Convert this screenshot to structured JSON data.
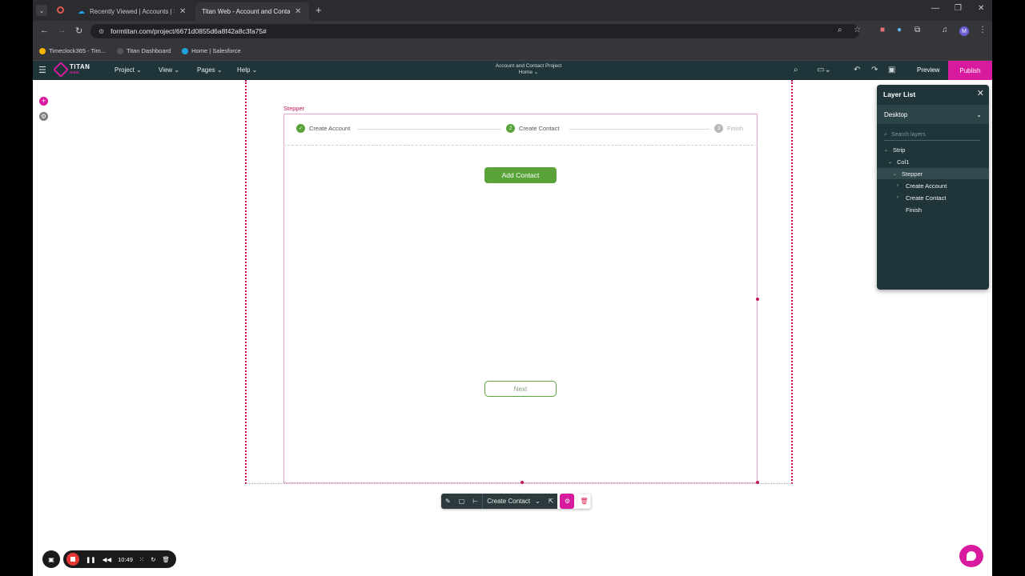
{
  "browser": {
    "tabs": [
      {
        "title": "Recently Viewed | Accounts | Sa",
        "active": false
      },
      {
        "title": "Titan Web - Account and Conta",
        "active": true
      }
    ],
    "url": "formtitan.com/project/6671d0855d6a8f42a8c3fa75#",
    "bookmarks": [
      "Timeclock365 - Tim...",
      "Titan Dashboard",
      "Home | Salesforce"
    ],
    "profile_initial": "M"
  },
  "header": {
    "logo": "TITAN",
    "logo_sub": "WEB",
    "menu": [
      "Project",
      "View",
      "Pages",
      "Help"
    ],
    "project_name": "Account and Contact Project",
    "page_name": "Home",
    "preview": "Preview",
    "publish": "Publish"
  },
  "canvas": {
    "stepper_label": "Stepper",
    "steps": [
      {
        "number": "✓",
        "label": "Create Account",
        "state": "done"
      },
      {
        "number": "2",
        "label": "Create Contact",
        "state": "active"
      },
      {
        "number": "3",
        "label": "Finish",
        "state": "pending"
      }
    ],
    "add_contact_label": "Add Contact",
    "next_label": "Next"
  },
  "toolbar": {
    "component_select": "Create Contact"
  },
  "layer_list": {
    "title": "Layer List",
    "device": "Desktop",
    "search_placeholder": "Search layers",
    "items": [
      {
        "label": "Strip",
        "caret": "⌄"
      },
      {
        "label": "Col1",
        "caret": "⌄"
      },
      {
        "label": "Stepper",
        "caret": "⌄",
        "selected": true
      },
      {
        "label": "Create Account",
        "caret": "›"
      },
      {
        "label": "Create Contact",
        "caret": "›"
      },
      {
        "label": "Finish",
        "caret": ""
      }
    ]
  },
  "recording": {
    "time": "10:49"
  },
  "colors": {
    "accent_magenta": "#d81b9e",
    "header_bg": "#1f3539",
    "step_green": "#5aa33a"
  }
}
